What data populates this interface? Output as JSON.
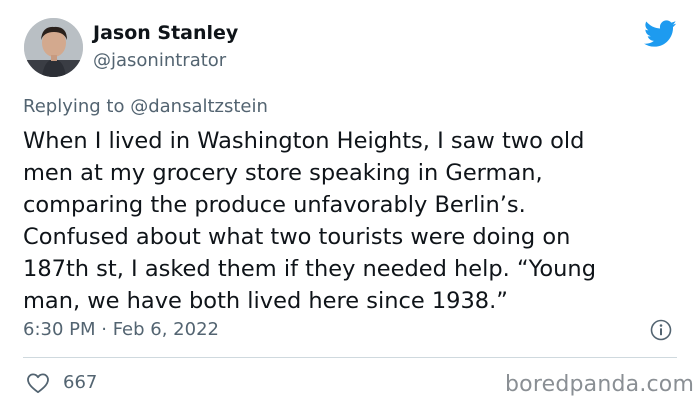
{
  "tweet": {
    "author": {
      "display_name": "Jason Stanley",
      "handle": "@jasonintrator"
    },
    "reply_to": "Replying to @dansaltzstein",
    "body_lines": [
      "When I lived in Washington Heights, I saw two old",
      "men at my grocery store speaking in German,",
      "comparing the produce unfavorably Berlin’s.",
      "Confused about what two tourists were doing on",
      "187th st, I asked them if they needed help. “Young",
      "man, we have both lived here since 1938.”"
    ],
    "timestamp": "6:30 PM · Feb 6, 2022",
    "like_count": "667"
  },
  "watermark": "boredpanda.com",
  "icons": {
    "brand": "twitter-bird-icon",
    "info": "info-icon",
    "like": "heart-icon"
  },
  "colors": {
    "twitter_blue": "#1d9bf0",
    "text_primary": "#0f1419",
    "text_secondary": "#536471",
    "divider": "#cfd9de"
  }
}
